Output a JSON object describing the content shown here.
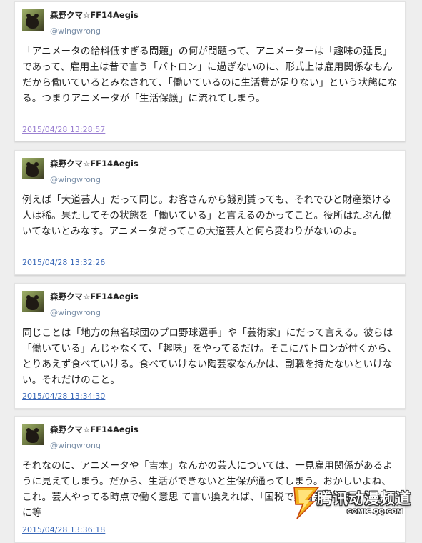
{
  "posts": [
    {
      "user_name": "森野クマ☆FF14Aegis",
      "handle": "@wingwrong",
      "text": "「アニメータの給料低すぎる問題」の何が問題って、アニメーターは「趣味の延長」であって、雇用主は昔で言う「パトロン」に過ぎないのに、形式上は雇用関係なもんだから働いているとみなされて、「働いているのに生活費が足りない」という状態になる。つまりアニメータが「生活保護」に流れてしまう。",
      "timestamp": "2015/04/28 13:28:57",
      "timestamp_visited": true
    },
    {
      "user_name": "森野クマ☆FF14Aegis",
      "handle": "@wingwrong",
      "text": "例えば「大道芸人」だって同じ。お客さんから餞別貰っても、それでひと財産築ける人は稀。果たしてその状態を「働いている」と言えるのかってこと。役所はたぶん働いてないとみなす。アニメータだってこの大道芸人と何ら変わりがないのよ。",
      "timestamp": "2015/04/28 13:32:26",
      "timestamp_visited": false
    },
    {
      "user_name": "森野クマ☆FF14Aegis",
      "handle": "@wingwrong",
      "text": "同じことは「地方の無名球団のプロ野球選手」や「芸術家」にだって言える。彼らは「働いている」んじゃなくて、「趣味」をやってるだけ。そこにパトロンが付くから、とりあえず食べていける。食べていけない陶芸家なんかは、副職を持たないといけない。それだけのこと。",
      "timestamp": "2015/04/28 13:34:30",
      "timestamp_visited": false
    },
    {
      "user_name": "森野クマ☆FF14Aegis",
      "handle": "@wingwrong",
      "text": "それなのに、アニメータや「吉本」なんかの芸人については、一見雇用関係があるように見えてしまう。だから、生活ができないと生保が通ってしまう。おかしいよね、これ。芸人やってる時点で働く意思",
      "text_cont": "て言い換えれば、「国税で無名芸人を雇ってる」に等",
      "timestamp": "2015/04/28 13:36:18",
      "timestamp_visited": false
    }
  ],
  "watermark": {
    "title": "腾讯动漫频道",
    "subtitle": "COMIC.QQ.COM"
  },
  "colors": {
    "background": "#eeeeee",
    "card": "#ffffff",
    "handle": "#7a8fa8",
    "link": "#3a68b8",
    "visited_link": "#9a7fd1"
  }
}
